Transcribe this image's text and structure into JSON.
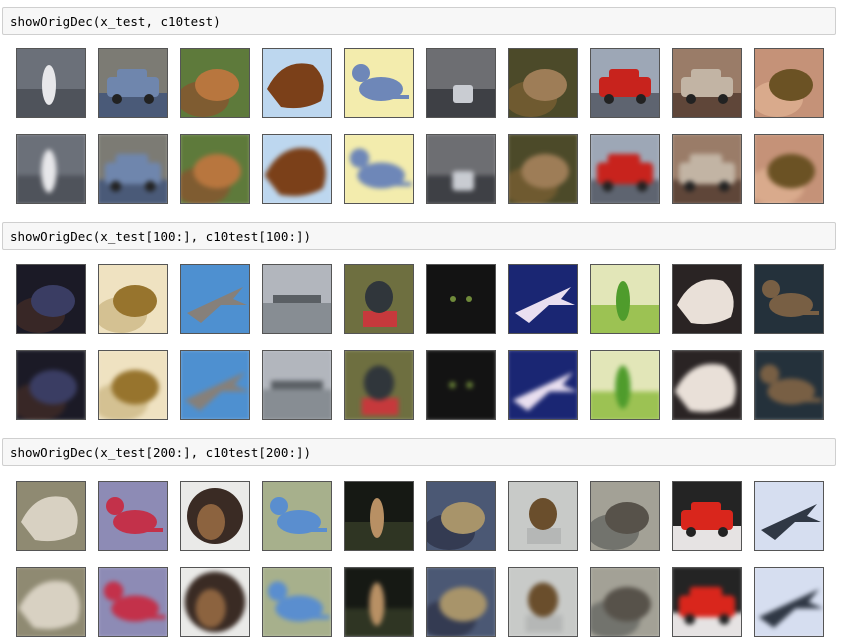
{
  "cells": [
    {
      "code": "showOrigDec(x_test, c10test)"
    },
    {
      "code": "showOrigDec(x_test[100:], c10test[100:])"
    },
    {
      "code": "showOrigDec(x_test[200:], c10test[200:])"
    }
  ],
  "image_sets": [
    {
      "images": [
        {
          "subject": "bird",
          "bg": "#6b7079",
          "c2": "#4f535b",
          "fg": "#e7e7ea",
          "shape": "tall"
        },
        {
          "subject": "truck",
          "bg": "#7c7b74",
          "c2": "#4a5a78",
          "fg": "#6f86ad",
          "shape": "car"
        },
        {
          "subject": "cat",
          "bg": "#5e7a3b",
          "c2": "#7f5c31",
          "fg": "#b8763e",
          "shape": "blob"
        },
        {
          "subject": "horse",
          "bg": "#bdd7ef",
          "c2": "#8fc1e6",
          "fg": "#7b4019",
          "shape": "head"
        },
        {
          "subject": "cat",
          "bg": "#f3ecad",
          "c2": "#e3d78a",
          "fg": "#6e87b8",
          "shape": "animal"
        },
        {
          "subject": "car",
          "bg": "#6d6e72",
          "c2": "#3e4045",
          "fg": "#c9ccd2",
          "shape": "carsmall"
        },
        {
          "subject": "frog",
          "bg": "#4c4a29",
          "c2": "#6f5a30",
          "fg": "#9e7d57",
          "shape": "blob"
        },
        {
          "subject": "truck",
          "bg": "#9da7b6",
          "c2": "#5e6470",
          "fg": "#c8231d",
          "shape": "car"
        },
        {
          "subject": "car",
          "bg": "#9a7c68",
          "c2": "#5f4639",
          "fg": "#c2b4a4",
          "shape": "car"
        },
        {
          "subject": "frog",
          "bg": "#c59278",
          "c2": "#d9aa8c",
          "fg": "#6b5224",
          "shape": "blob"
        }
      ]
    },
    {
      "images": [
        {
          "subject": "deer",
          "bg": "#1b1a26",
          "c2": "#382726",
          "fg": "#3a3d63",
          "shape": "blob"
        },
        {
          "subject": "frog",
          "bg": "#efe2c1",
          "c2": "#d4c192",
          "fg": "#97742d",
          "shape": "blob"
        },
        {
          "subject": "airplane",
          "bg": "#4e90d0",
          "c2": "#7cb0e0",
          "fg": "#86807a",
          "shape": "plane"
        },
        {
          "subject": "airplane",
          "bg": "#b2b6bd",
          "c2": "#878d93",
          "fg": "#5a5f64",
          "shape": "ground"
        },
        {
          "subject": "bird",
          "bg": "#6e6f40",
          "c2": "#c6393c",
          "fg": "#30363b",
          "shape": "bird"
        },
        {
          "subject": "cat",
          "bg": "#131313",
          "c2": "#23232a",
          "fg": "#3f4a2f",
          "shape": "eyes"
        },
        {
          "subject": "ship",
          "bg": "#1a2673",
          "c2": "#2c3f9a",
          "fg": "#e9dff0",
          "shape": "plane"
        },
        {
          "subject": "bird",
          "bg": "#e2e6b8",
          "c2": "#9cc253",
          "fg": "#4f9c2c",
          "shape": "tall"
        },
        {
          "subject": "bird",
          "bg": "#2a2424",
          "c2": "#c4b1a4",
          "fg": "#e9e0d8",
          "shape": "head"
        },
        {
          "subject": "deer",
          "bg": "#24313b",
          "c2": "#3d4d3c",
          "fg": "#785f44",
          "shape": "animal"
        }
      ]
    },
    {
      "images": [
        {
          "subject": "deer",
          "bg": "#8f8a72",
          "c2": "#6b5b49",
          "fg": "#d8d1c2",
          "shape": "head"
        },
        {
          "subject": "deer",
          "bg": "#8d8bb5",
          "c2": "#a56e4d",
          "fg": "#c3314a",
          "shape": "animal"
        },
        {
          "subject": "dog",
          "bg": "#eaeae8",
          "c2": "#3a2b24",
          "fg": "#8c633f",
          "shape": "circle"
        },
        {
          "subject": "dog",
          "bg": "#a7b08c",
          "c2": "#c78aa8",
          "fg": "#5a8ecf",
          "shape": "animal"
        },
        {
          "subject": "deer",
          "bg": "#161914",
          "c2": "#2f3523",
          "fg": "#b89064",
          "shape": "tall"
        },
        {
          "subject": "frog",
          "bg": "#4b5874",
          "c2": "#343b52",
          "fg": "#a8946a",
          "shape": "blob"
        },
        {
          "subject": "bird",
          "bg": "#c8cac8",
          "c2": "#b5b7b6",
          "fg": "#6a4e2c",
          "shape": "bird"
        },
        {
          "subject": "cat",
          "bg": "#a3a196",
          "c2": "#72736d",
          "fg": "#57524a",
          "shape": "blob"
        },
        {
          "subject": "automobile",
          "bg": "#242424",
          "c2": "#e6e3e3",
          "fg": "#d9261c",
          "shape": "car"
        },
        {
          "subject": "airplane",
          "bg": "#d6def0",
          "c2": "#c3cde6",
          "fg": "#303845",
          "shape": "plane"
        }
      ]
    }
  ]
}
